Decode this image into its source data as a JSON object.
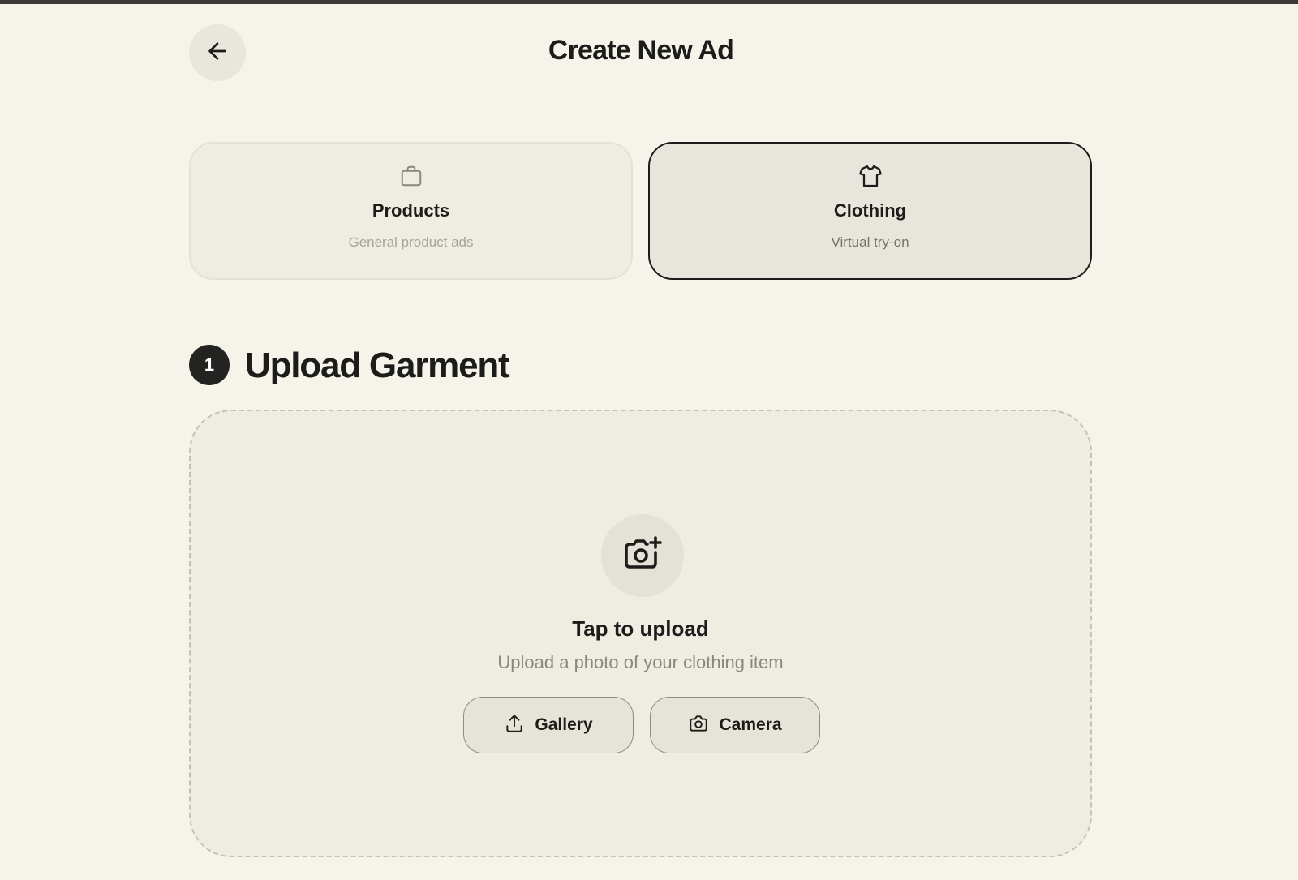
{
  "header": {
    "title": "Create New Ad",
    "back_icon": "arrow-left-icon"
  },
  "ad_types": [
    {
      "name": "Products",
      "description": "General product ads",
      "icon": "shopping-bag-icon",
      "selected": false
    },
    {
      "name": "Clothing",
      "description": "Virtual try-on",
      "icon": "shirt-icon",
      "selected": true
    }
  ],
  "step": {
    "number": "1",
    "title": "Upload Garment"
  },
  "upload": {
    "icon": "camera-plus-icon",
    "title": "Tap to upload",
    "subtitle": "Upload a photo of your clothing item",
    "gallery_label": "Gallery",
    "gallery_icon": "upload-icon",
    "camera_label": "Camera",
    "camera_icon": "camera-icon"
  },
  "colors": {
    "background": "#f5f3ea",
    "card": "#efece2",
    "selected_border": "#1c1c1a",
    "badge": "#232321"
  }
}
